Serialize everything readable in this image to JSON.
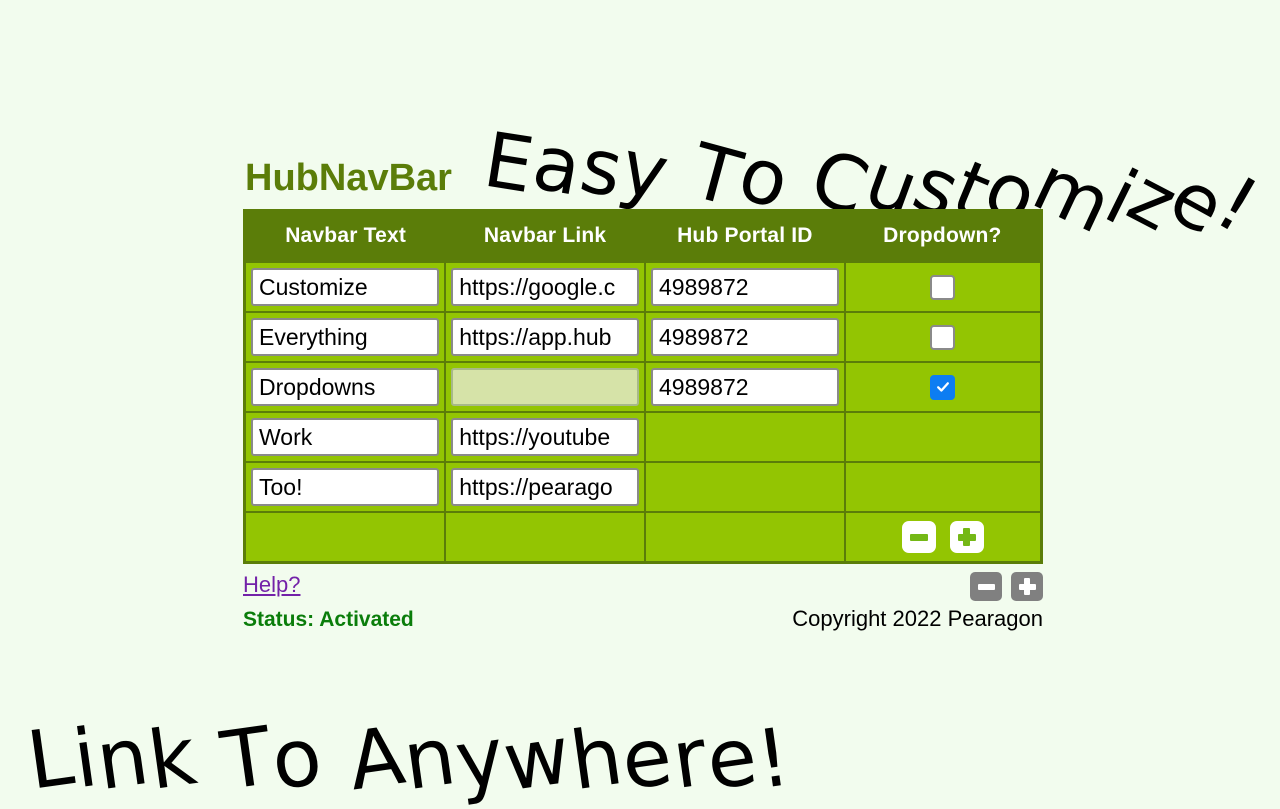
{
  "page": {
    "background_color": "#f2fcee",
    "app_title": "HubNavBar",
    "accent_dark": "#5b7d09",
    "accent_light": "#93c502",
    "checkbox_checked_color": "#0d7df2"
  },
  "captions": {
    "top": "Easy To Customize!",
    "bottom": "Link To Anywhere!"
  },
  "table": {
    "headers": [
      "Navbar Text",
      "Navbar Link",
      "Hub Portal ID",
      "Dropdown?"
    ],
    "rows": [
      {
        "navbar_text": "Customize",
        "navbar_link": "https://google.c",
        "hub_portal_id": "4989872",
        "dropdown_checked": false,
        "link_disabled": false,
        "has_text_input": true,
        "has_link_input": true,
        "has_id_input": true,
        "has_checkbox": true
      },
      {
        "navbar_text": "Everything",
        "navbar_link": "https://app.hub",
        "hub_portal_id": "4989872",
        "dropdown_checked": false,
        "link_disabled": false,
        "has_text_input": true,
        "has_link_input": true,
        "has_id_input": true,
        "has_checkbox": true
      },
      {
        "navbar_text": "Dropdowns",
        "navbar_link": "",
        "hub_portal_id": "4989872",
        "dropdown_checked": true,
        "link_disabled": true,
        "has_text_input": true,
        "has_link_input": true,
        "has_id_input": true,
        "has_checkbox": true
      },
      {
        "navbar_text": "Work",
        "navbar_link": "https://youtube",
        "hub_portal_id": "",
        "dropdown_checked": false,
        "link_disabled": false,
        "has_text_input": true,
        "has_link_input": true,
        "has_id_input": false,
        "has_checkbox": false
      },
      {
        "navbar_text": "Too!",
        "navbar_link": "https://pearago",
        "hub_portal_id": "",
        "dropdown_checked": false,
        "link_disabled": false,
        "has_text_input": true,
        "has_link_input": true,
        "has_id_input": false,
        "has_checkbox": false
      }
    ],
    "controls_row": {
      "remove_row_icon": "minus-icon",
      "add_row_icon": "plus-icon"
    }
  },
  "footer": {
    "help_label": "Help?",
    "status_label": "Status: Activated",
    "copyright": "Copyright 2022 Pearagon",
    "remove_icon": "minus-icon",
    "add_icon": "plus-icon"
  }
}
